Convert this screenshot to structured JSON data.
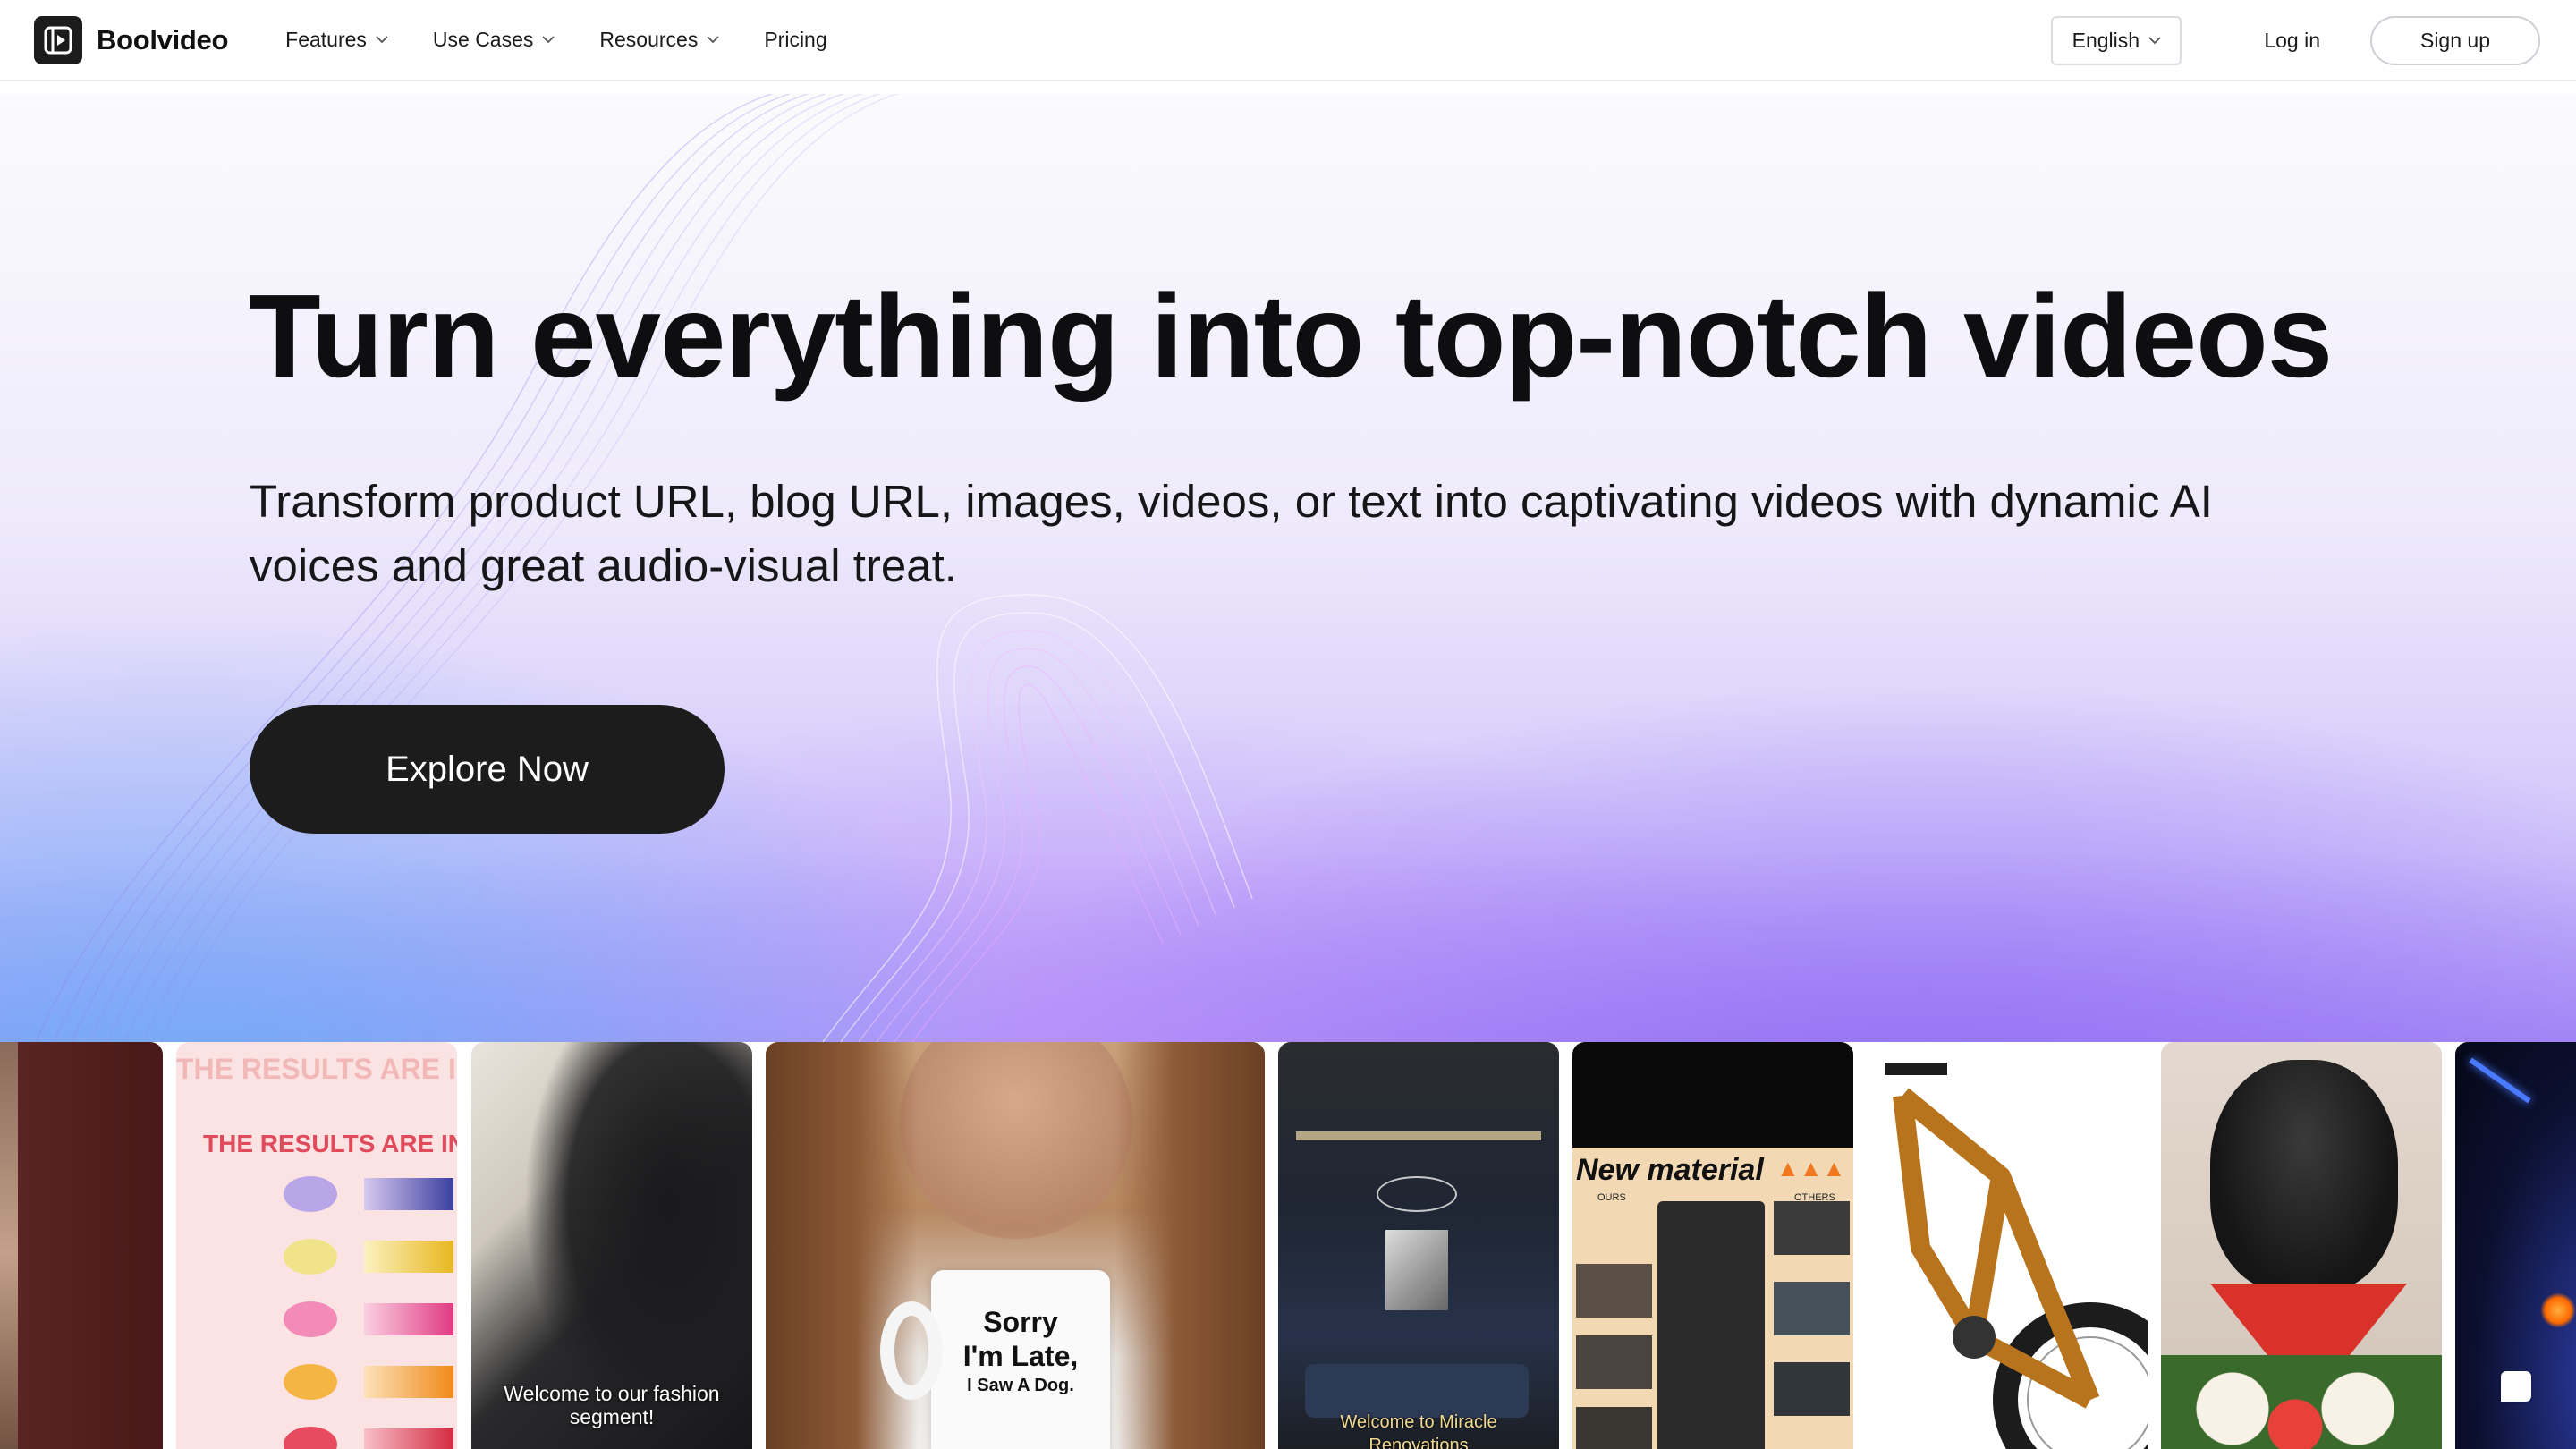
{
  "brand": {
    "name": "Boolvideo"
  },
  "nav": {
    "items": [
      {
        "label": "Features",
        "has_dropdown": true
      },
      {
        "label": "Use Cases",
        "has_dropdown": true
      },
      {
        "label": "Resources",
        "has_dropdown": true
      },
      {
        "label": "Pricing",
        "has_dropdown": false
      }
    ],
    "language": "English",
    "login": "Log in",
    "signup": "Sign up"
  },
  "hero": {
    "title": "Turn everything into top-notch videos",
    "subtitle": "Transform product URL, blog URL, images, videos, or text into captivating videos with dynamic AI voices and great audio-visual treat.",
    "cta": "Explore Now"
  },
  "gallery": {
    "cards": [
      {
        "name": "fashion-glitter-video",
        "caption": ""
      },
      {
        "name": "lip-gloss-results-video",
        "caption": "THE RESULTS ARE IN"
      },
      {
        "name": "fashion-segment-video",
        "caption": "Welcome to our fashion segment!"
      },
      {
        "name": "mug-video",
        "caption": ""
      },
      {
        "name": "interior-renovation-video",
        "caption": "Welcome to Miracle Renovations"
      },
      {
        "name": "car-seat-cover-video",
        "caption": "New material"
      },
      {
        "name": "bike-video",
        "caption": ""
      },
      {
        "name": "dog-video",
        "caption": ""
      },
      {
        "name": "night-sky-video",
        "caption": ""
      }
    ],
    "mug_text": [
      "Sorry",
      "I'm Late,",
      "I Saw A Dog."
    ],
    "lip_rows": [
      "THE RESULTS ARE IN"
    ],
    "material_labels": [
      "OURS",
      "OTHERS"
    ]
  },
  "colors": {
    "accent_dark": "#1c1c1c",
    "hero_purple": "#a78ef6",
    "hero_blue": "#6eb0f8"
  }
}
